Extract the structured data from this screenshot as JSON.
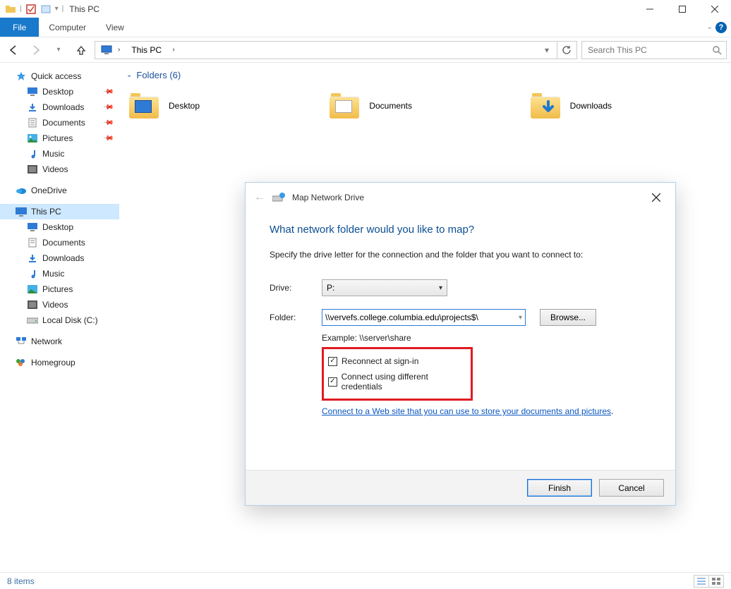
{
  "window_title": "This PC",
  "ribbon": {
    "file": "File",
    "computer": "Computer",
    "view": "View"
  },
  "nav": {
    "back_enabled": true,
    "forward_enabled": false,
    "crumb_root": "This PC",
    "search_placeholder": "Search This PC"
  },
  "sidebar": {
    "quick_access": "Quick access",
    "desktop": "Desktop",
    "downloads": "Downloads",
    "documents": "Documents",
    "pictures": "Pictures",
    "music": "Music",
    "videos": "Videos",
    "onedrive": "OneDrive",
    "this_pc": "This PC",
    "tp_desktop": "Desktop",
    "tp_documents": "Documents",
    "tp_downloads": "Downloads",
    "tp_music": "Music",
    "tp_pictures": "Pictures",
    "tp_videos": "Videos",
    "tp_localc": "Local Disk (C:)",
    "network": "Network",
    "homegroup": "Homegroup"
  },
  "content": {
    "group_folders_label": "Folders (6)",
    "folders": {
      "desktop": "Desktop",
      "documents": "Documents",
      "downloads": "Downloads"
    }
  },
  "dialog": {
    "title": "Map Network Drive",
    "heading": "What network folder would you like to map?",
    "instruction": "Specify the drive letter for the connection and the folder that you want to connect to:",
    "drive_label": "Drive:",
    "drive_value": "P:",
    "folder_label": "Folder:",
    "folder_value": "\\\\vervefs.college.columbia.edu\\projects$\\",
    "browse": "Browse...",
    "example": "Example: \\\\server\\share",
    "reconnect": "Reconnect at sign-in",
    "diffcred": "Connect using different credentials",
    "weblink": "Connect to a Web site that you can use to store your documents and pictures",
    "finish": "Finish",
    "cancel": "Cancel"
  },
  "status": {
    "items": "8 items"
  }
}
